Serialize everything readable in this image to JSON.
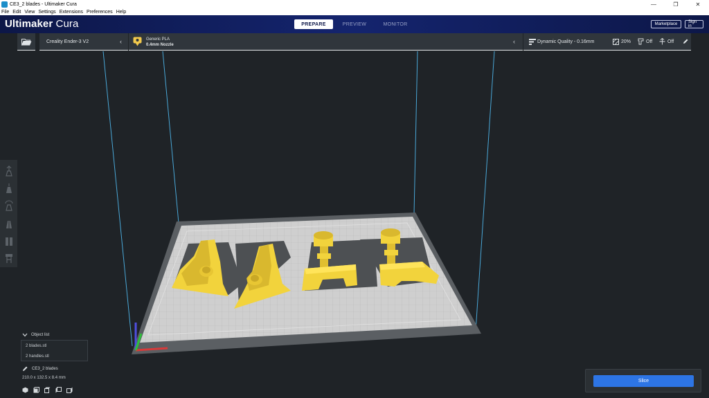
{
  "window": {
    "title": "CE3_2 blades - Ultimaker Cura",
    "controls": [
      "—",
      "❐",
      "✕"
    ]
  },
  "menu": [
    "File",
    "Edit",
    "View",
    "Settings",
    "Extensions",
    "Preferences",
    "Help"
  ],
  "header": {
    "brand_bold": "Ultimaker",
    "brand_light": " Cura",
    "tabs": [
      {
        "label": "PREPARE",
        "active": true
      },
      {
        "label": "PREVIEW",
        "active": false
      },
      {
        "label": "MONITOR",
        "active": false
      }
    ],
    "marketplace_label": "Marketplace",
    "signin_label": "Sign in"
  },
  "setup": {
    "printer": "Creality Ender-3 V2",
    "material": "Generic PLA",
    "nozzle": "0.4mm Nozzle",
    "profile": "Dynamic Quality - 0.16mm",
    "infill": "20%",
    "support": "Off",
    "adhesion": "Off"
  },
  "object_list": {
    "title": "Object list",
    "items": [
      "2 blades.stl",
      "2 handles.stl"
    ]
  },
  "job": {
    "name": "CE3_2 blades",
    "dimensions": "210.0 x 132.5 x 8.4 mm"
  },
  "slice": {
    "button_label": "Slice"
  },
  "colors": {
    "accent": "#2d75e5",
    "header_bg": "#0d1748",
    "model": "#f2d33c",
    "plate": "#c9c9c9",
    "background": "#1f2327"
  },
  "icons": {
    "toolbar": [
      "move-icon",
      "scale-icon",
      "rotate-icon",
      "mirror-icon",
      "per-model-settings-icon",
      "support-blocker-icon"
    ],
    "view": [
      "3d-view-icon",
      "front-view-icon",
      "top-view-icon",
      "left-view-icon",
      "right-view-icon"
    ]
  }
}
